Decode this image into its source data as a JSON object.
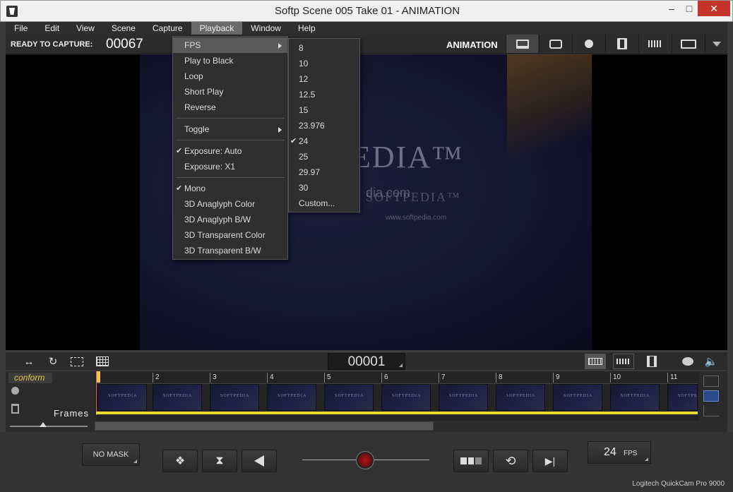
{
  "window": {
    "title": "Softp  Scene 005  Take 01 - ANIMATION",
    "minimize": "–",
    "maximize": "□",
    "close": "✕"
  },
  "menubar": [
    "File",
    "Edit",
    "View",
    "Scene",
    "Capture",
    "Playback",
    "Window",
    "Help"
  ],
  "status": {
    "ready": "READY TO CAPTURE:",
    "counter": "00067",
    "mode": "ANIMATION"
  },
  "viewport": {
    "logo": "EDIA™",
    "url": "dia.com",
    "watermark": "SOFTPEDIA™",
    "watermark_url": "www.softpedia.com"
  },
  "playback_menu": [
    {
      "label": "FPS",
      "submenu": true
    },
    {
      "label": "Play to Black"
    },
    {
      "label": "Loop"
    },
    {
      "label": "Short Play"
    },
    {
      "label": "Reverse"
    },
    {
      "label": "Toggle",
      "submenu": true
    },
    {
      "label": "Exposure: Auto",
      "checked": true
    },
    {
      "label": "Exposure: X1"
    },
    {
      "label": "Mono",
      "checked": true
    },
    {
      "label": "3D Anaglyph Color"
    },
    {
      "label": "3D Anaglyph B/W"
    },
    {
      "label": "3D Transparent Color"
    },
    {
      "label": "3D Transparent B/W"
    }
  ],
  "fps_menu": [
    {
      "label": "8"
    },
    {
      "label": "10"
    },
    {
      "label": "12"
    },
    {
      "label": "12.5"
    },
    {
      "label": "15"
    },
    {
      "label": "23.976"
    },
    {
      "label": "24",
      "checked": true
    },
    {
      "label": "25"
    },
    {
      "label": "29.97"
    },
    {
      "label": "30"
    },
    {
      "label": "Custom..."
    }
  ],
  "timeline": {
    "counter": "00001",
    "conform": "conform",
    "frames_label": "Frames",
    "ticks": [
      "",
      "2",
      "3",
      "4",
      "5",
      "6",
      "7",
      "8",
      "9",
      "10",
      "11"
    ]
  },
  "transport": {
    "mask": "NO MASK",
    "fps_value": "24",
    "fps_unit": "FPS",
    "camera": "Logitech QuickCam Pro 9000"
  },
  "colors": {
    "accent_yellow": "#e8d830",
    "record_red": "#b01818",
    "close_red": "#c7342a"
  }
}
